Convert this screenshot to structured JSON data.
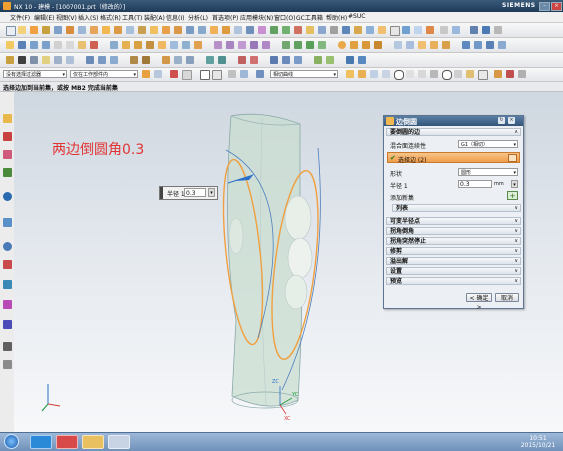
{
  "window": {
    "title": "NX 10 - 建模 - [1007001.prt（修改的）]",
    "brand": "SIEMENS"
  },
  "menu": [
    "文件(F)",
    "编辑(E)",
    "视图(V)",
    "插入(S)",
    "格式(R)",
    "工具(T)",
    "装配(A)",
    "信息(I)",
    "分析(L)",
    "首选项(P)",
    "应用模块(N)",
    "窗口(O)",
    "GC工具箱",
    "帮助(H)",
    "#SUC"
  ],
  "toolbar": {
    "filter_label": "没有选择过滤器",
    "scope_label": "仅在工作部件内",
    "snap_label": "相切曲线"
  },
  "status_prompt": "选择边加到当前集，或按 MB2 完成当前集",
  "annotation": "两边倒圆角0.3",
  "radius_box": {
    "label": "半径 1",
    "value": "0.3"
  },
  "dialog": {
    "title": "边倒圆",
    "sections": {
      "blend_edges": "要倒圆的边",
      "variable_radius": "可变半径点",
      "corner_setback": "拐角倒角",
      "corner_stop": "拐角突然停止",
      "trim": "修剪",
      "overflow": "溢出解",
      "settings": "设置",
      "preview": "预览"
    },
    "continuity_label": "混合面连续性",
    "continuity_value": "G1（相切）",
    "select_edge": "选择边 (2)",
    "shape_label": "形状",
    "shape_value": "圆形",
    "radius_label": "半径 1",
    "radius_value": "0.3",
    "radius_unit": "mm",
    "add_set": "添加新集",
    "list": "列表",
    "ok": "< 确定 >",
    "cancel": "取消"
  },
  "axes": {
    "zc": "ZC",
    "yc": "YC",
    "xc": "XC"
  },
  "taskbar": {
    "time": "10:51",
    "date": "2015/10/21"
  }
}
